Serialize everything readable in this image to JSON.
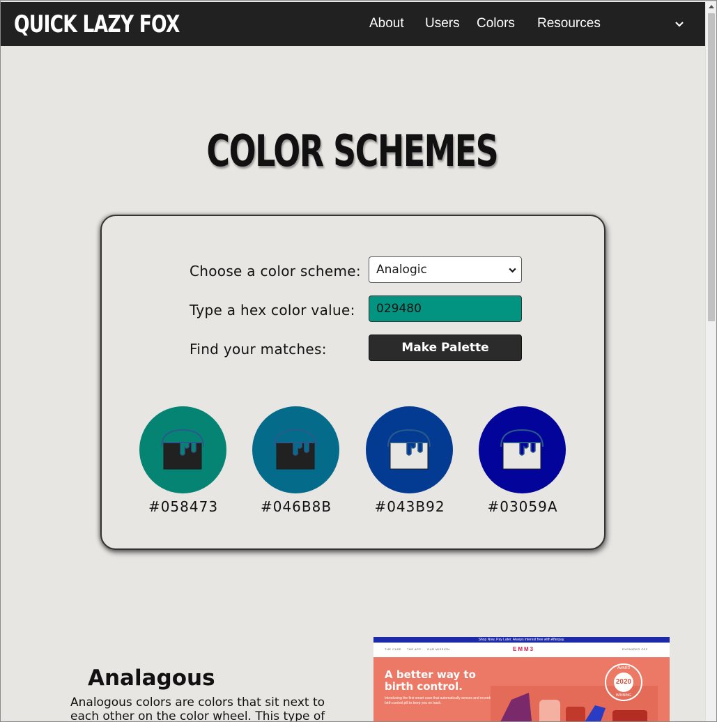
{
  "nav": {
    "brand": "QUICK LAZY FOX",
    "links": [
      "About",
      "Users",
      "Colors",
      "Resources"
    ]
  },
  "page": {
    "title": "COLOR SCHEMES"
  },
  "form": {
    "scheme_label": "Choose a color scheme:",
    "scheme_value": "Analogic",
    "hex_label": "Type a hex color value:",
    "hex_value": "029480",
    "hex_color": "#029480",
    "match_label": "Find your matches:",
    "button_label": "Make Palette"
  },
  "palette": [
    {
      "hex": "#058473",
      "icon": "paint-bucket-icon",
      "bucket_fill": "#212121"
    },
    {
      "hex": "#046B8B",
      "icon": "paint-bucket-icon",
      "bucket_fill": "#212121"
    },
    {
      "hex": "#043B92",
      "icon": "paint-bucket-icon",
      "bucket_fill": "#e8e6e3"
    },
    {
      "hex": "#03059A",
      "icon": "paint-bucket-icon",
      "bucket_fill": "#e8e6e3"
    }
  ],
  "section": {
    "title": "Analagous",
    "text": "Analogous colors are colors that sit next to each other on the color wheel. This type of"
  },
  "preview": {
    "topbar": "Shop Now, Pay Later. Always interest free with Afterpay.",
    "nav_items": [
      "THE CASE",
      "THE APP",
      "OUR MISSION"
    ],
    "logo": "EMM3",
    "cart_label": "EXPANDED OFF",
    "headline_1": "A better way to",
    "headline_2": "birth control.",
    "sub": "Introducing the first smart case that automatically senses and records your birth control pill to keep you on track.",
    "badge_year": "2020",
    "badge_top": "AWARD",
    "badge_bottom": "WINNING"
  },
  "colors": {
    "navbar": "#212121",
    "background": "#e8e6e3",
    "button": "#2b2b2b"
  }
}
